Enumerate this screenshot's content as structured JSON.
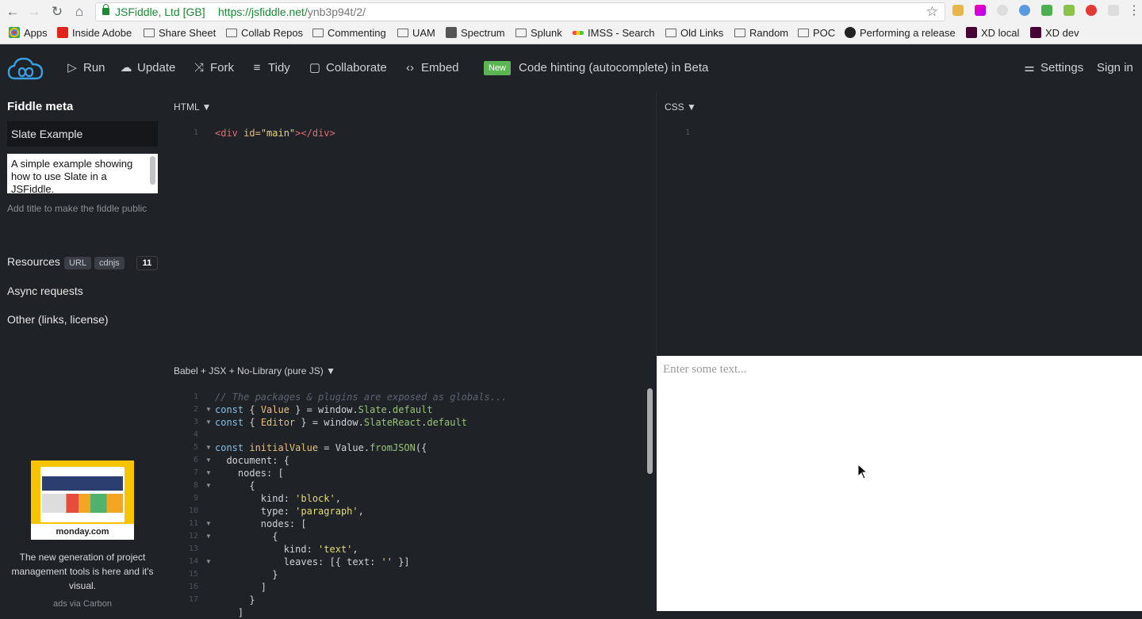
{
  "browser": {
    "secure_label": "JSFiddle, Ltd [GB]",
    "url_host": "https://jsfiddle.net/",
    "url_path": "ynb3p94t/2/",
    "bookmarks": [
      {
        "label": "Apps",
        "icon": "apps-grid-icon"
      },
      {
        "label": "Inside Adobe",
        "icon": "adobe-icon"
      },
      {
        "label": "Share Sheet",
        "icon": "folder-icon"
      },
      {
        "label": "Collab Repos",
        "icon": "folder-icon"
      },
      {
        "label": "Commenting",
        "icon": "folder-icon"
      },
      {
        "label": "UAM",
        "icon": "folder-icon"
      },
      {
        "label": "Spectrum",
        "icon": "spectrum-icon"
      },
      {
        "label": "Splunk",
        "icon": "folder-icon"
      },
      {
        "label": "IMSS - Search",
        "icon": "imss-icon"
      },
      {
        "label": "Old Links",
        "icon": "folder-icon"
      },
      {
        "label": "Random",
        "icon": "folder-icon"
      },
      {
        "label": "POC",
        "icon": "folder-icon"
      },
      {
        "label": "Performing a release",
        "icon": "github-icon"
      },
      {
        "label": "XD local",
        "icon": "xd-icon"
      },
      {
        "label": "XD dev",
        "icon": "xd-icon"
      }
    ]
  },
  "toolbar": {
    "run": "Run",
    "update": "Update",
    "fork": "Fork",
    "tidy": "Tidy",
    "collaborate": "Collaborate",
    "embed": "Embed",
    "new_badge": "New",
    "announcement": "Code hinting (autocomplete) in Beta",
    "settings": "Settings",
    "signin": "Sign in"
  },
  "sidebar": {
    "heading": "Fiddle meta",
    "title_value": "Slate Example",
    "description_value": "A simple example showing how to use Slate in a JSFiddle.",
    "hint": "Add title to make the fiddle public",
    "resources": "Resources",
    "chip_url": "URL",
    "chip_cdnjs": "cdnjs",
    "resources_count": "11",
    "async": "Async requests",
    "other": "Other (links, license)",
    "ad_brand": "monday.com",
    "ad_text": "The new generation of project management tools is here and it's visual.",
    "ad_by": "ads via Carbon"
  },
  "panels": {
    "html_label": "HTML ▼",
    "css_label": "CSS ▼",
    "js_label": "Babel + JSX + No-Library (pure JS) ▼",
    "result_placeholder": "Enter some text..."
  },
  "html_code": {
    "line": "1",
    "open_tag": "<div",
    "attr": " id=",
    "attr_val": "\"main\"",
    "close": "></div>"
  },
  "css_code": {
    "line": "1"
  },
  "js_code": {
    "line_numbers": [
      "1",
      "2",
      "3",
      "4",
      "5",
      "6",
      "7",
      "8",
      "9",
      "10",
      "11",
      "12",
      "13",
      "14",
      "15",
      "16",
      "17"
    ],
    "l1": "// The packages & plugins are exposed as globals...",
    "l2": [
      "const",
      " { ",
      "Value",
      " } = window.",
      "Slate",
      ".",
      "default"
    ],
    "l3": [
      "const",
      " { ",
      "Editor",
      " } = window.",
      "SlateReact",
      ".",
      "default"
    ],
    "l5": [
      "const",
      " initialValue",
      " = Value.",
      "fromJSON",
      "({"
    ],
    "l6": "  document: {",
    "l7": "    nodes: [",
    "l8": "      {",
    "l9": [
      "        kind: ",
      "'block'",
      ","
    ],
    "l10": [
      "        type: ",
      "'paragraph'",
      ","
    ],
    "l11": "        nodes: [",
    "l12": "          {",
    "l13": [
      "            kind: ",
      "'text'",
      ","
    ],
    "l14": [
      "            leaves: [{ text: ",
      "''",
      " }]"
    ],
    "l15": "          }",
    "l16": "        ]",
    "l17": "      }",
    "l18": "    ]"
  }
}
